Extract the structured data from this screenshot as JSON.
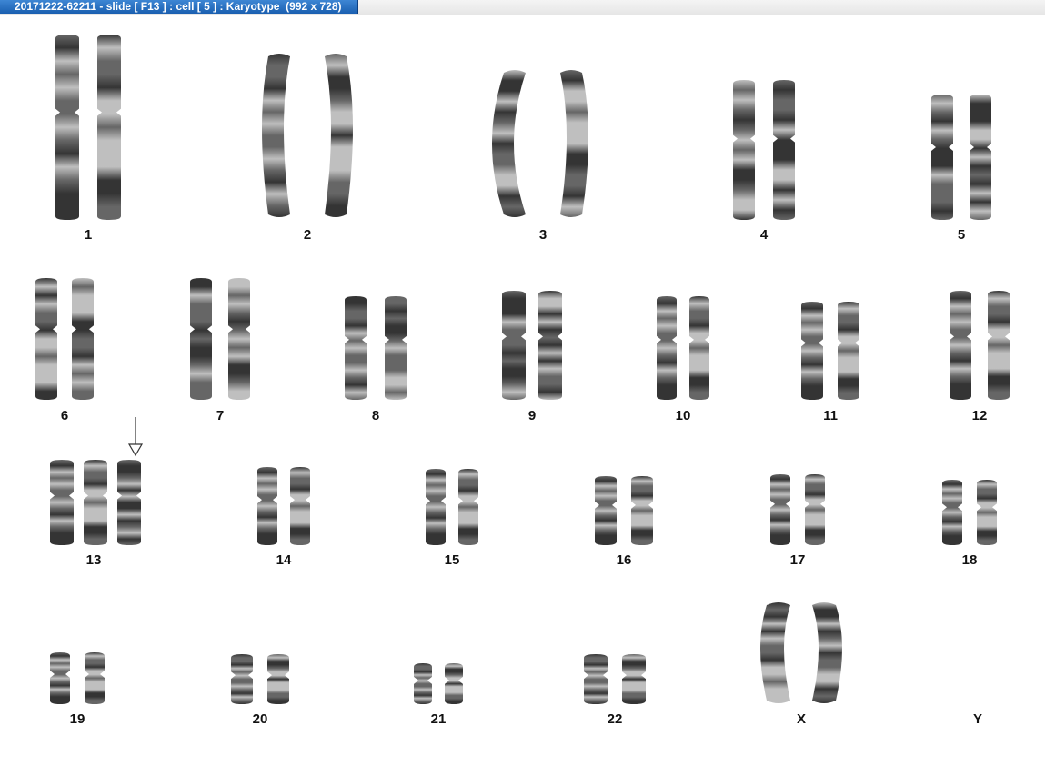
{
  "window": {
    "title": "20171222-62211 - slide [ F13 ] : cell [ 5 ] : Karyotype  (992 x 728)"
  },
  "karyotype": {
    "groups": [
      {
        "label": "1",
        "copies": 2
      },
      {
        "label": "2",
        "copies": 2
      },
      {
        "label": "3",
        "copies": 2
      },
      {
        "label": "4",
        "copies": 2
      },
      {
        "label": "5",
        "copies": 2
      },
      {
        "label": "6",
        "copies": 2
      },
      {
        "label": "7",
        "copies": 2
      },
      {
        "label": "8",
        "copies": 2
      },
      {
        "label": "9",
        "copies": 2
      },
      {
        "label": "10",
        "copies": 2
      },
      {
        "label": "11",
        "copies": 2
      },
      {
        "label": "12",
        "copies": 2
      },
      {
        "label": "13",
        "copies": 3
      },
      {
        "label": "14",
        "copies": 2
      },
      {
        "label": "15",
        "copies": 2
      },
      {
        "label": "16",
        "copies": 2
      },
      {
        "label": "17",
        "copies": 2
      },
      {
        "label": "18",
        "copies": 2
      },
      {
        "label": "19",
        "copies": 2
      },
      {
        "label": "20",
        "copies": 2
      },
      {
        "label": "21",
        "copies": 2
      },
      {
        "label": "22",
        "copies": 2
      },
      {
        "label": "X",
        "copies": 2
      },
      {
        "label": "Y",
        "copies": 0
      }
    ],
    "marker": {
      "target": "13",
      "icon": "down-arrow-icon"
    }
  },
  "colors": {
    "titlebar_accent": "#1a5fb0",
    "chromosome_dark": "#1e1e1e",
    "chromosome_light": "#b8b8b8"
  }
}
